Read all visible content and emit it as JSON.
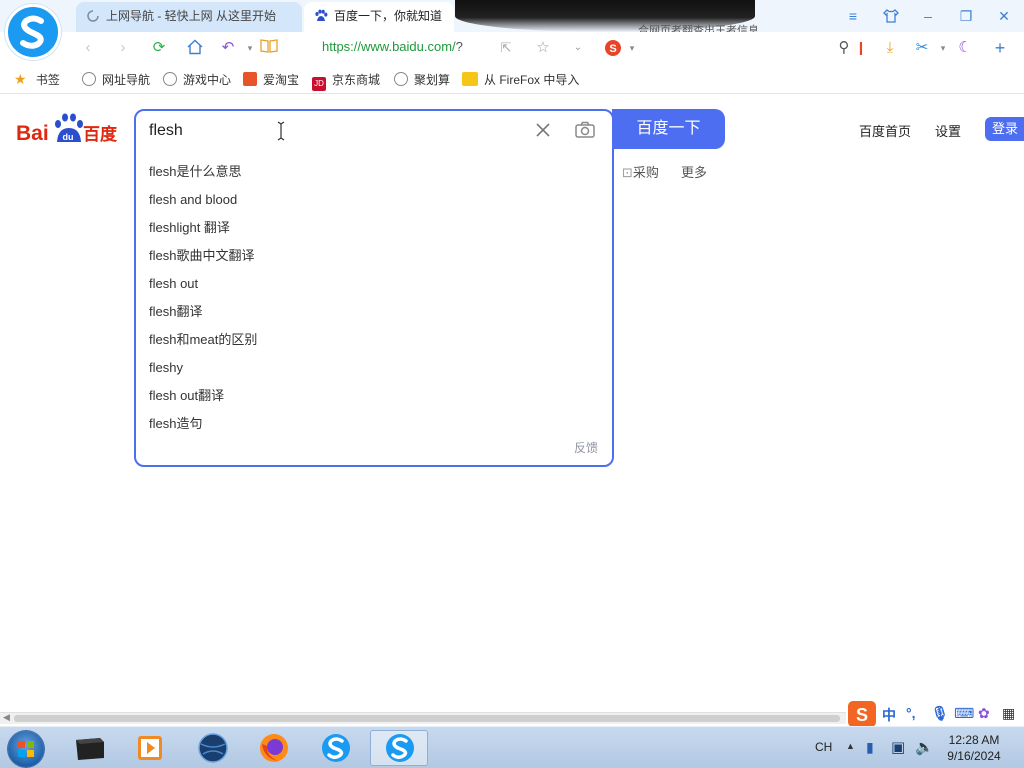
{
  "browser": {
    "tabs": [
      {
        "title": "上网导航 - 轻快上网 从这里开始",
        "active": false
      },
      {
        "title": "百度一下，你就知道",
        "active": true
      }
    ],
    "header_fragment": "合网页者翻查出王者信息",
    "url": {
      "scheme_host": "https://www.baidu.com/",
      "rest": "?"
    },
    "bookmarks": [
      {
        "label": "书签",
        "icon": "star-icon"
      },
      {
        "label": "网址导航",
        "icon": "globe-icon"
      },
      {
        "label": "游戏中心",
        "icon": "globe-icon"
      },
      {
        "label": "爱淘宝",
        "icon": "taobao-icon"
      },
      {
        "label": "京东商城",
        "icon": "jd-icon"
      },
      {
        "label": "聚划算",
        "icon": "globe-icon"
      },
      {
        "label": "从 FireFox 中导入",
        "icon": "folder-icon"
      }
    ]
  },
  "page": {
    "search": {
      "query": "flesh",
      "button_label": "百度一下",
      "suggestions": [
        "flesh是什么意思",
        "flesh and blood",
        "fleshlight 翻译",
        "flesh歌曲中文翻译",
        "flesh out",
        "flesh翻译",
        "flesh和meat的区别",
        "fleshy",
        "flesh out翻译",
        "flesh造句"
      ],
      "feedback_label": "反馈"
    },
    "top_links": {
      "home": "百度首页",
      "settings": "设置",
      "login": "登录"
    },
    "more_row": {
      "shopping": "采购",
      "more": "更多"
    }
  },
  "taskbar": {
    "language": "CH",
    "time": "12:28 AM",
    "date": "9/16/2024",
    "ime_mode": "中"
  },
  "colors": {
    "accent": "#4e6ef2",
    "url_green": "#1e9a3c",
    "chrome_blue": "#3d7fd6"
  }
}
